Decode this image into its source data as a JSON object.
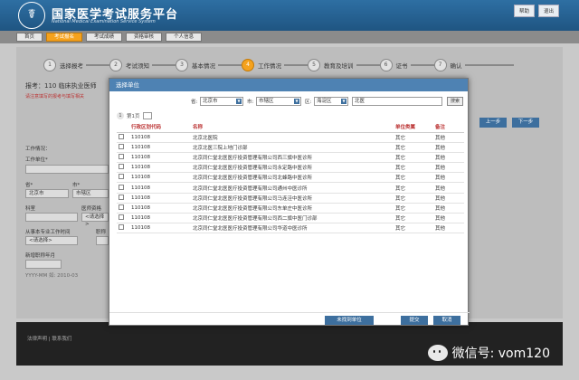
{
  "header": {
    "title": "国家医学考试服务平台",
    "subtitle": "National Medical Examination Service System",
    "links": [
      "帮助",
      "退出"
    ]
  },
  "nav": {
    "tabs": [
      {
        "label": "首页",
        "active": false
      },
      {
        "label": "考试报名",
        "active": true
      },
      {
        "label": "考试成绩",
        "active": false
      },
      {
        "label": "资格审核",
        "active": false
      },
      {
        "label": "个人信息",
        "active": false
      }
    ]
  },
  "steps": [
    {
      "num": "1",
      "label": "选择报考",
      "active": false
    },
    {
      "num": "2",
      "label": "考试须知",
      "active": false
    },
    {
      "num": "3",
      "label": "基本情况",
      "active": false
    },
    {
      "num": "4",
      "label": "工作情况",
      "active": true
    },
    {
      "num": "5",
      "label": "教育及培训",
      "active": false
    },
    {
      "num": "6",
      "label": "证书",
      "active": false
    },
    {
      "num": "7",
      "label": "确认",
      "active": false
    }
  ],
  "bg": {
    "heading": "报考：110 临床执业医师",
    "note": "请注意填写的报考与填写相关",
    "prev": "上一步",
    "next": "下一步",
    "section": "工作情况：",
    "work_unit": "工作单位*",
    "province": "省*",
    "city": "市*",
    "province_val": "北京市",
    "city_val": "市辖区",
    "dept": "科室",
    "tech": "医师资格",
    "select_ph": "<请选择>",
    "work_time": "从事本专业工作时间",
    "title_field": "职称",
    "job_start": "新增职称年月",
    "date_ph": "YYYY-MM 如: 2010-03"
  },
  "modal": {
    "title": "选择单位",
    "province_lbl": "省:",
    "province": "北京市",
    "city_lbl": "市:",
    "city": "市辖区",
    "district_lbl": "区:",
    "district": "海淀区",
    "search_val": "北医",
    "search_btn": "搜索",
    "page_label": "第1页",
    "columns": [
      "行政区划代码",
      "名称",
      "单位类属",
      "备注"
    ],
    "rows": [
      {
        "code": "110108",
        "name": "北京北医院",
        "type": "其它",
        "note": "其他"
      },
      {
        "code": "110108",
        "name": "北京北医三院上地门诊部",
        "type": "其它",
        "note": "其他"
      },
      {
        "code": "110108",
        "name": "北京同仁堂北医医疗投资管理有限公司西三旗中医诊所",
        "type": "其它",
        "note": "其他"
      },
      {
        "code": "110108",
        "name": "北京同仁堂北医医疗投资管理有限公司永定路中医诊所",
        "type": "其它",
        "note": "其他"
      },
      {
        "code": "110108",
        "name": "北京同仁堂北医医疗投资管理有限公司北蜂路中医诊所",
        "type": "其它",
        "note": "其他"
      },
      {
        "code": "110108",
        "name": "北京同仁堂北医医疗投资管理有限公司通州中医诊所",
        "type": "其它",
        "note": "其他"
      },
      {
        "code": "110108",
        "name": "北京同仁堂北医医疗投资管理有限公司马连洼中医诊所",
        "type": "其它",
        "note": "其他"
      },
      {
        "code": "110108",
        "name": "北京同仁堂北医医疗投资管理有限公司东单庄中医诊所",
        "type": "其它",
        "note": "其他"
      },
      {
        "code": "110108",
        "name": "北京同仁堂北医医疗投资管理有限公司西二旗中医门诊部",
        "type": "其它",
        "note": "其他"
      },
      {
        "code": "110108",
        "name": "北京同仁堂北医医疗投资管理有限公司华道中医诊所",
        "type": "其它",
        "note": "其他"
      }
    ],
    "notfound_btn": "未找到单位",
    "submit_btn": "提交",
    "cancel_btn": "取消"
  },
  "footer": {
    "text": "法律声明 | 联系我们"
  },
  "watermark": {
    "text": "微信号: vom120"
  },
  "colors": {
    "header": "#2e6fa3",
    "accent": "#f5a21d",
    "button": "#3d6f9e",
    "modal_head": "#4e82b3"
  }
}
